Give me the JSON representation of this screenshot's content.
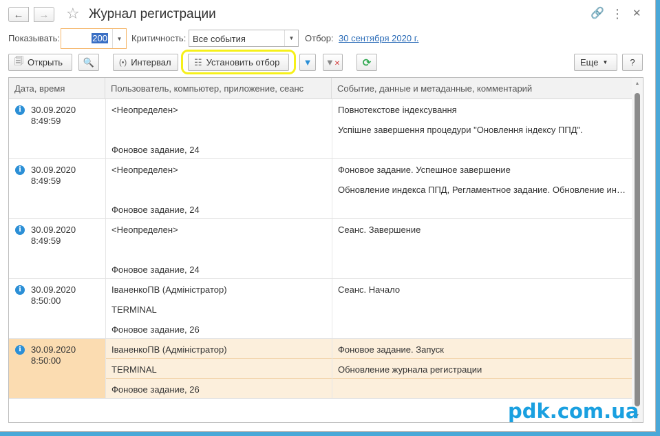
{
  "window": {
    "title": "Журнал регистрации"
  },
  "filter": {
    "show_label": "Показывать:",
    "show_value": "200",
    "criticality_label": "Критичность:",
    "criticality_value": "Все события",
    "selection_label": "Отбор:",
    "selection_value": "30 сентября 2020 г."
  },
  "toolbar": {
    "open_label": "Открыть",
    "interval_label": "Интервал",
    "set_filter_label": "Установить отбор",
    "more_label": "Еще",
    "help_label": "?"
  },
  "table": {
    "columns": [
      "Дата, время",
      "Пользователь, компьютер, приложение, сеанс",
      "Событие, данные и метаданные, комментарий"
    ],
    "rows": [
      {
        "date": "30.09.2020",
        "time": "8:49:59",
        "user": "<Неопределен>",
        "computer": "",
        "session": "Фоновое задание, 24",
        "event": "Повнотекстове індексування",
        "data": "Успішне завершення процедури \"Оновлення індексу ППД\"."
      },
      {
        "date": "30.09.2020",
        "time": "8:49:59",
        "user": "<Неопределен>",
        "computer": "",
        "session": "Фоновое задание, 24",
        "event": "Фоновое задание. Успешное завершение",
        "data": "Обновление индекса ППД, Регламентное задание. Обновление индекса ППД"
      },
      {
        "date": "30.09.2020",
        "time": "8:49:59",
        "user": "<Неопределен>",
        "computer": "",
        "session": "Фоновое задание, 24",
        "event": "Сеанс. Завершение",
        "data": ""
      },
      {
        "date": "30.09.2020",
        "time": "8:50:00",
        "user": "ІваненкоПВ (Адміністратор)",
        "computer": "TERMINAL",
        "session": "Фоновое задание, 26",
        "event": "Сеанс. Начало",
        "data": ""
      },
      {
        "date": "30.09.2020",
        "time": "8:50:00",
        "user": "ІваненкоПВ (Адміністратор)",
        "computer": "TERMINAL",
        "session": "Фоновое задание, 26",
        "event": "Фоновое задание. Запуск",
        "data": "Обновление журнала регистрации"
      }
    ]
  },
  "watermark": "pdk.com.ua",
  "colors": {
    "accent_link": "#2a6bb7",
    "highlight": "#f6f01a",
    "selected_row": "#fcefdc",
    "watermark": "#1aa0e0"
  }
}
